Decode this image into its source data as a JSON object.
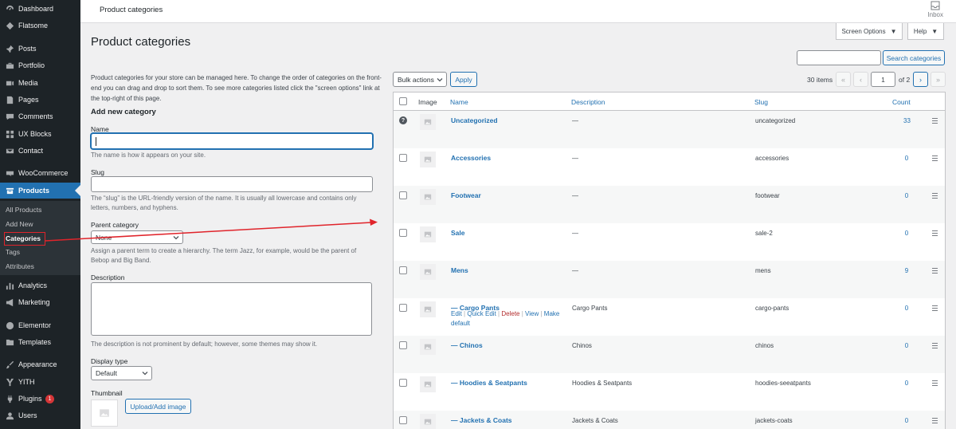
{
  "sidebar": {
    "items": [
      {
        "label": "Dashboard",
        "icon": "dashboard-icon"
      },
      {
        "label": "Flatsome",
        "icon": "flatsome-icon"
      },
      {
        "label": "Posts",
        "icon": "pin-icon"
      },
      {
        "label": "Portfolio",
        "icon": "portfolio-icon"
      },
      {
        "label": "Media",
        "icon": "media-icon"
      },
      {
        "label": "Pages",
        "icon": "page-icon"
      },
      {
        "label": "Comments",
        "icon": "comment-icon"
      },
      {
        "label": "UX Blocks",
        "icon": "ux-blocks-icon"
      },
      {
        "label": "Contact",
        "icon": "envelope-icon"
      },
      {
        "label": "WooCommerce",
        "icon": "woocommerce-icon"
      },
      {
        "label": "Products",
        "icon": "archive-icon"
      },
      {
        "label": "Analytics",
        "icon": "bar-chart-icon"
      },
      {
        "label": "Marketing",
        "icon": "megaphone-icon"
      },
      {
        "label": "Elementor",
        "icon": "elementor-icon"
      },
      {
        "label": "Templates",
        "icon": "folder-icon"
      },
      {
        "label": "Appearance",
        "icon": "paintbrush-icon"
      },
      {
        "label": "YITH",
        "icon": "yith-icon"
      },
      {
        "label": "Plugins",
        "icon": "plug-icon",
        "badge": "1"
      },
      {
        "label": "Users",
        "icon": "user-icon"
      }
    ],
    "submenu": [
      "All Products",
      "Add New",
      "Categories",
      "Tags",
      "Attributes"
    ]
  },
  "topbar": {
    "title": "Product categories",
    "inbox": "Inbox"
  },
  "screen_options": "Screen Options",
  "help": "Help",
  "page_title": "Product categories",
  "intro": "Product categories for your store can be managed here. To change the order of categories on the front-end you can drag and drop to sort them. To see more categories listed click the \"screen options\" link at the top-right of this page.",
  "form": {
    "heading": "Add new category",
    "name_label": "Name",
    "name_help": "The name is how it appears on your site.",
    "slug_label": "Slug",
    "slug_help": "The “slug” is the URL-friendly version of the name. It is usually all lowercase and contains only letters, numbers, and hyphens.",
    "parent_label": "Parent category",
    "parent_value": "None",
    "parent_help": "Assign a parent term to create a hierarchy. The term Jazz, for example, would be the parent of Bebop and Big Band.",
    "description_label": "Description",
    "description_help": "The description is not prominent by default; however, some themes may show it.",
    "display_type_label": "Display type",
    "display_type_value": "Default",
    "thumbnail_label": "Thumbnail",
    "upload_button": "Upload/Add image"
  },
  "search_button": "Search categories",
  "bulk_actions": "Bulk actions",
  "apply": "Apply",
  "pagination": {
    "items": "30 items",
    "first": "«",
    "prev": "‹",
    "current": "1",
    "of": "of 2",
    "next": "›",
    "last": "»"
  },
  "table": {
    "headers": {
      "image": "Image",
      "name": "Name",
      "description": "Description",
      "slug": "Slug",
      "count": "Count"
    },
    "row_actions": {
      "edit": "Edit",
      "quick_edit": "Quick Edit",
      "delete": "Delete",
      "view": "View",
      "make_default": "Make default",
      "sep": "|"
    },
    "rows": [
      {
        "name": "Uncategorized",
        "description": "—",
        "slug": "uncategorized",
        "count": "33"
      },
      {
        "name": "Accessories",
        "description": "—",
        "slug": "accessories",
        "count": "0"
      },
      {
        "name": "Footwear",
        "description": "—",
        "slug": "footwear",
        "count": "0"
      },
      {
        "name": "Sale",
        "description": "—",
        "slug": "sale-2",
        "count": "0"
      },
      {
        "name": "Mens",
        "description": "—",
        "slug": "mens",
        "count": "9"
      },
      {
        "name": "— Cargo Pants",
        "description": "Cargo Pants",
        "slug": "cargo-pants",
        "count": "0"
      },
      {
        "name": "— Chinos",
        "description": "Chinos",
        "slug": "chinos",
        "count": "0"
      },
      {
        "name": "— Hoodies & Seatpants",
        "description": "Hoodies & Seatpants",
        "slug": "hoodies-seeatpants",
        "count": "0"
      },
      {
        "name": "— Jackets & Coats",
        "description": "Jackets & Coats",
        "slug": "jackets-coats",
        "count": "0"
      }
    ]
  },
  "colors": {
    "sidebar": "#1d2327",
    "accent": "#2271b1",
    "annotation": "#e0242b"
  }
}
